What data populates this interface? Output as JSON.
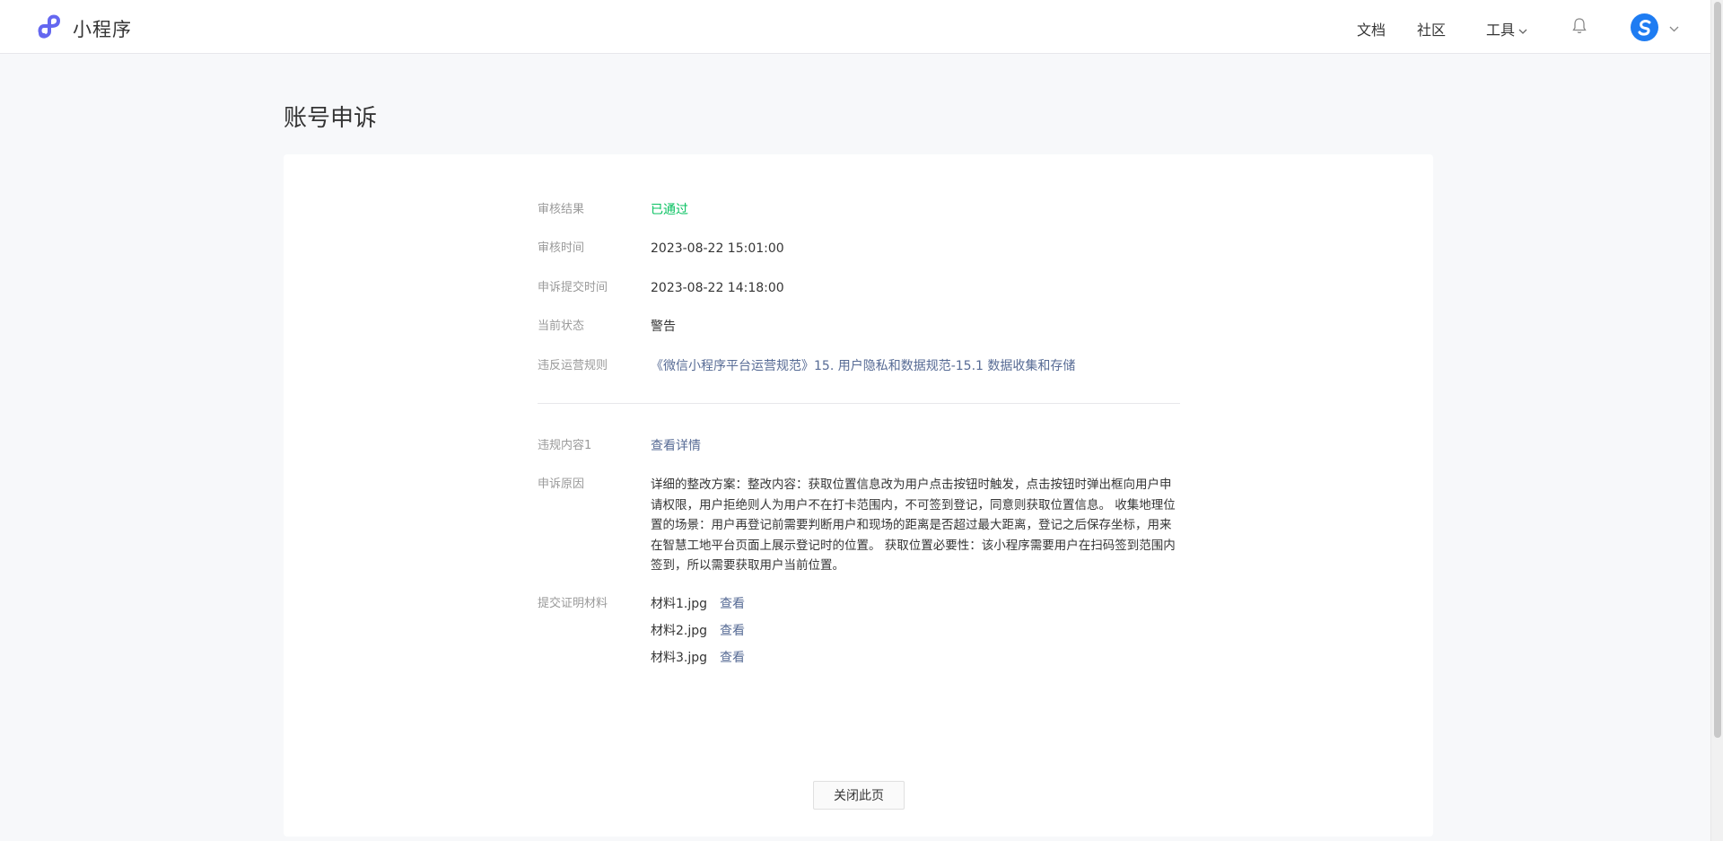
{
  "header": {
    "app_name": "小程序",
    "nav": {
      "docs": "文档",
      "community": "社区",
      "tools": "工具"
    }
  },
  "page": {
    "title": "账号申诉"
  },
  "details": {
    "review_result": {
      "label": "审核结果",
      "value": "已通过",
      "color": "#07c160"
    },
    "review_time": {
      "label": "审核时间",
      "value": "2023-08-22 15:01:00"
    },
    "submit_time": {
      "label": "申诉提交时间",
      "value": "2023-08-22 14:18:00"
    },
    "current_status": {
      "label": "当前状态",
      "value": "警告"
    },
    "violated_rule": {
      "label": "违反运营规则",
      "value": "《微信小程序平台运营规范》15. 用户隐私和数据规范-15.1 数据收集和存储"
    },
    "violation_content": {
      "label": "违规内容1",
      "value": "查看详情"
    },
    "appeal_reason": {
      "label": "申诉原因",
      "value": "详细的整改方案：整改内容：获取位置信息改为用户点击按钮时触发，点击按钮时弹出框向用户申请权限，用户拒绝则人为用户不在打卡范围内，不可签到登记，同意则获取位置信息。 收集地理位置的场景：用户再登记前需要判断用户和现场的距离是否超过最大距离，登记之后保存坐标，用来在智慧工地平台页面上展示登记时的位置。 获取位置必要性：该小程序需要用户在扫码签到范围内签到，所以需要获取用户当前位置。"
    },
    "materials": {
      "label": "提交证明材料",
      "files": [
        {
          "name": "材料1.jpg",
          "action": "查看"
        },
        {
          "name": "材料2.jpg",
          "action": "查看"
        },
        {
          "name": "材料3.jpg",
          "action": "查看"
        }
      ]
    }
  },
  "actions": {
    "close": "关闭此页"
  },
  "colors": {
    "link": "#576b95",
    "brand": "#6467f0",
    "avatar": "#1e7cf2"
  },
  "icons": [
    "miniprogram-logo-icon",
    "chevron-down-icon",
    "bell-icon",
    "avatar-icon"
  ]
}
